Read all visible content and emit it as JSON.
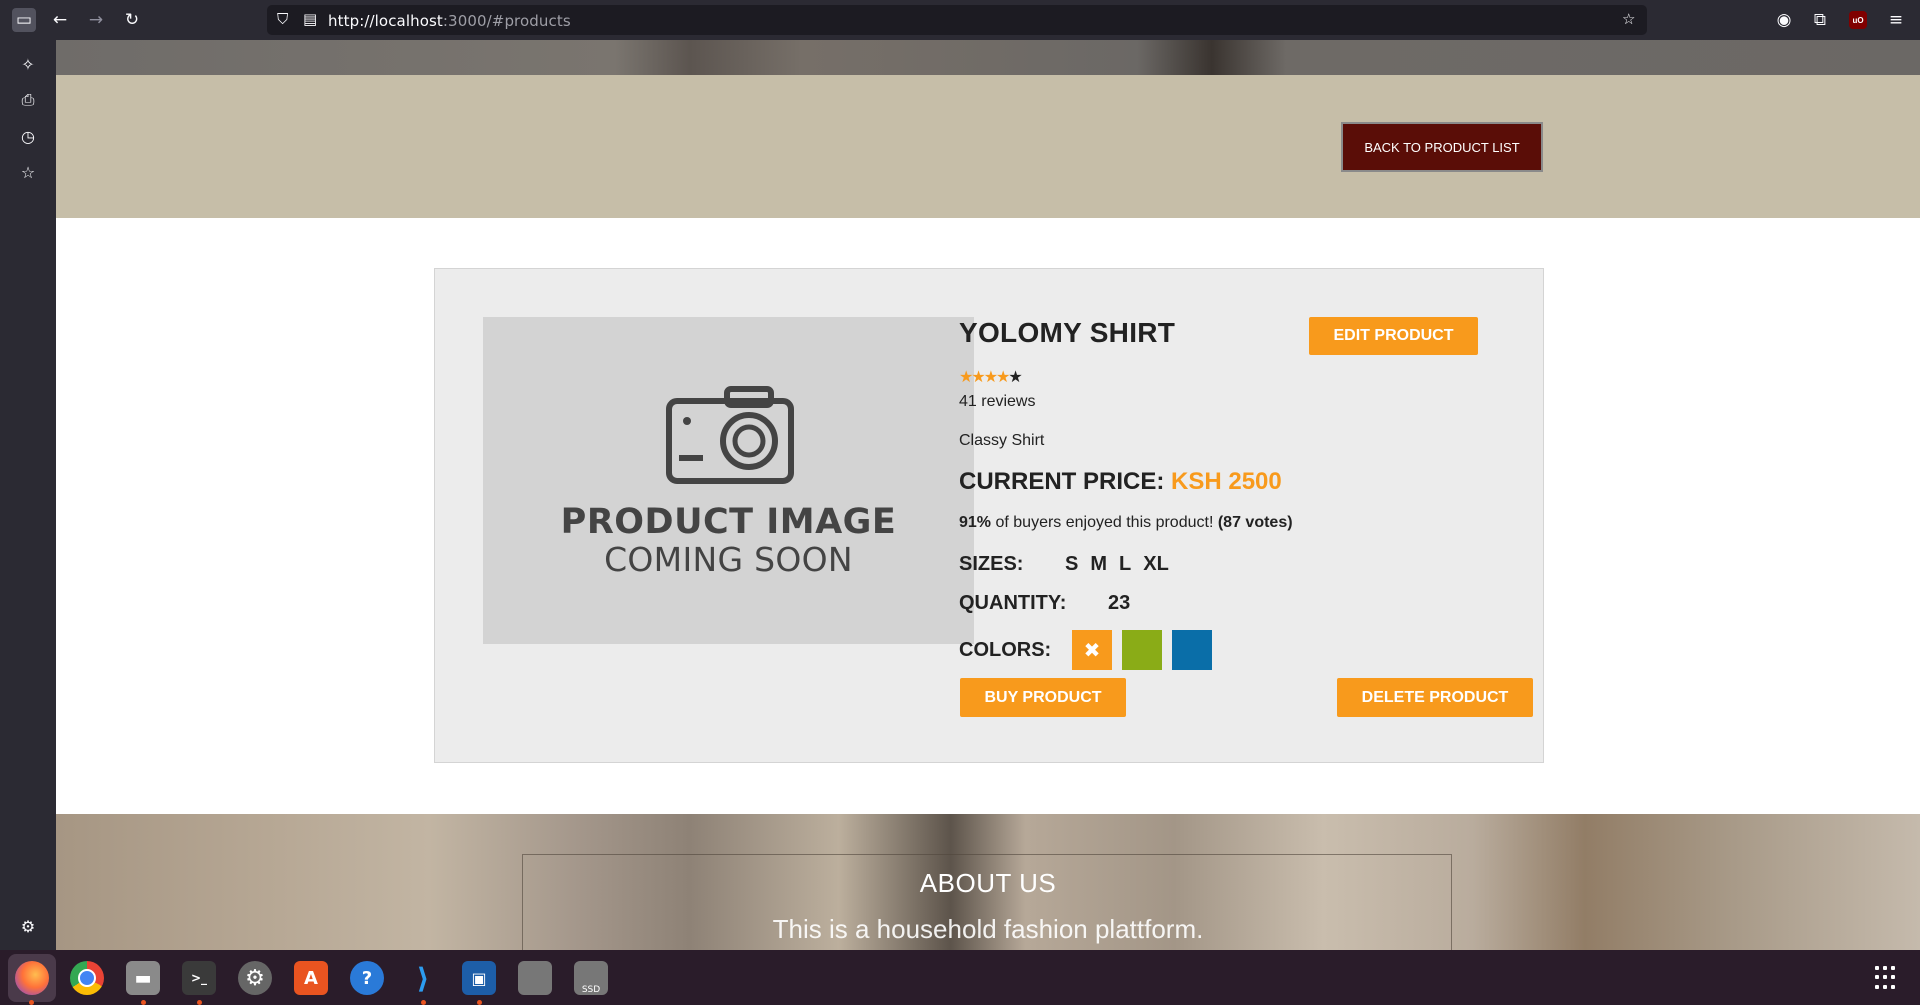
{
  "browser": {
    "url_host": "http://localhost",
    "url_rest": ":3000/#products"
  },
  "page": {
    "back_button": "BACK TO PRODUCT LIST",
    "image_placeholder": {
      "line1": "PRODUCT IMAGE",
      "line2": "COMING SOON"
    },
    "product": {
      "name": "YOLOMY SHIRT",
      "rating": 4,
      "rating_max": 5,
      "reviews": "41 reviews",
      "description": "Classy Shirt",
      "price_label": "CURRENT PRICE:",
      "price": "KSH 2500",
      "enjoy_percent": "91%",
      "enjoy_text": "of buyers enjoyed this product!",
      "votes": "(87 votes)",
      "sizes_label": "SIZES:",
      "sizes": [
        "S",
        "M",
        "L",
        "XL"
      ],
      "quantity_label": "QUANTITY:",
      "quantity": "23",
      "colors_label": "COLORS:",
      "colors": [
        "#f89a1c",
        "#8aac17",
        "#0a6ea8"
      ],
      "selected_color_mark": "✖"
    },
    "buttons": {
      "edit": "EDIT PRODUCT",
      "buy": "BUY PRODUCT",
      "delete": "DELETE PRODUCT"
    },
    "about": {
      "title": "ABOUT US",
      "subtitle": "This is a household fashion plattform."
    }
  },
  "taskbar": {
    "apps": [
      "firefox-icon",
      "chrome-icon",
      "files-icon",
      "terminal-icon",
      "settings-icon",
      "app-center-icon",
      "help-icon",
      "vscode-icon",
      "virtualbox-icon",
      "disk-icon",
      "ssd-icon"
    ],
    "ssd_label": "SSD"
  },
  "colors": {
    "accent": "#f89a1c",
    "back_button": "#5a0d07",
    "band": "#c6bea8"
  }
}
